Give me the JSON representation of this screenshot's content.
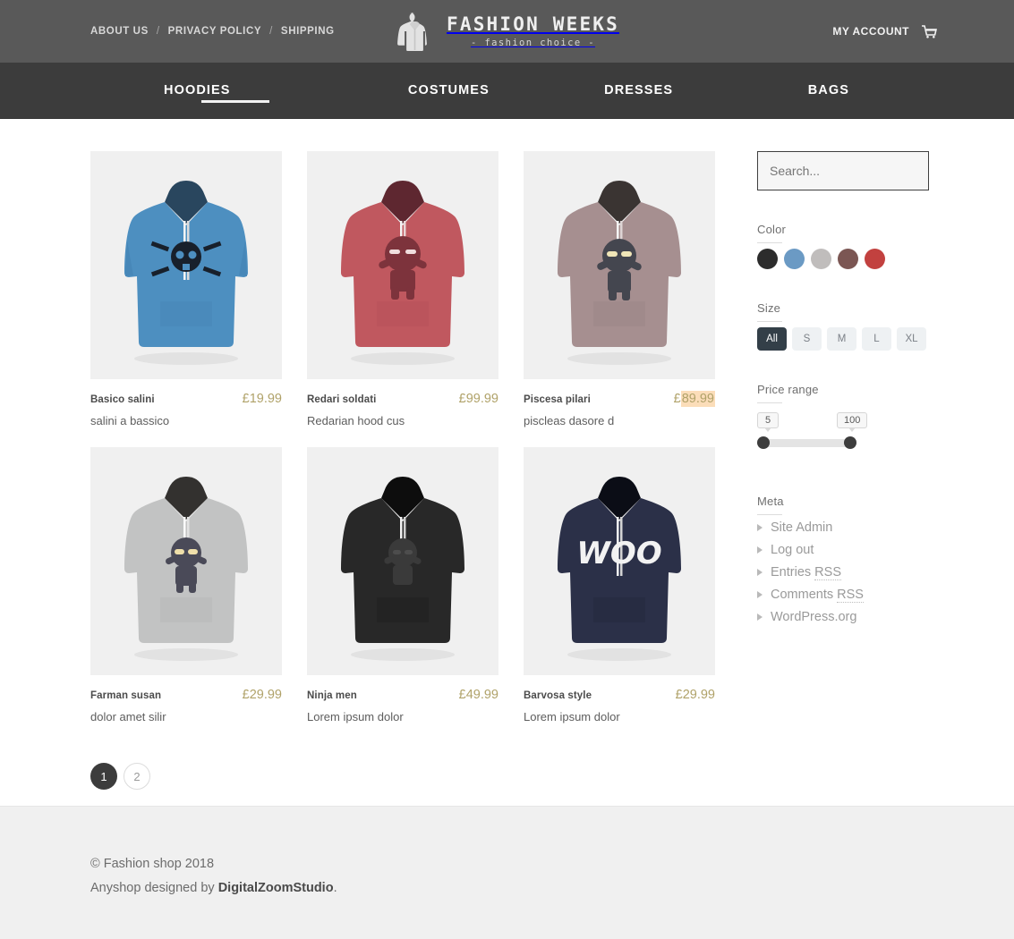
{
  "topbar": {
    "links": [
      {
        "label": "ABOUT US"
      },
      {
        "label": "PRIVACY POLICY"
      },
      {
        "label": "SHIPPING"
      }
    ],
    "separator": "/",
    "logo": {
      "title": "FASHION WEEKS",
      "subtitle": "- fashion choice -",
      "icon": "hoodie-icon"
    },
    "account_label": "MY ACCOUNT",
    "cart_icon": "shopping-cart-icon"
  },
  "nav": {
    "items": [
      {
        "label": "HOODIES",
        "active": true
      },
      {
        "label": "COSTUMES",
        "active": false
      },
      {
        "label": "DRESSES",
        "active": false
      },
      {
        "label": "BAGS",
        "active": false
      }
    ]
  },
  "products": [
    {
      "name": "Basico salini",
      "price": "£19.99",
      "desc": "salini a bassico",
      "selected_price": false,
      "image": "blue-skull-hoodie"
    },
    {
      "name": "Redari soldati",
      "price": "£99.99",
      "desc": "Redarian hood cus",
      "selected_price": false,
      "image": "red-ninja-hoodie"
    },
    {
      "name": "Piscesa pilari",
      "price": "£89.99",
      "desc": "piscleas dasore d",
      "selected_price": true,
      "image": "mauve-ninja-hoodie"
    },
    {
      "name": "Farman susan",
      "price": "£29.99",
      "desc": "dolor amet silir",
      "selected_price": false,
      "image": "gray-ninja-hoodie"
    },
    {
      "name": "Ninja men",
      "price": "£49.99",
      "desc": "Lorem ipsum dolor",
      "selected_price": false,
      "image": "black-ninja-hoodie"
    },
    {
      "name": "Barvosa style",
      "price": "£29.99",
      "desc": "Lorem ipsum dolor",
      "selected_price": false,
      "image": "navy-woo-hoodie"
    }
  ],
  "pagination": {
    "pages": [
      {
        "label": "1",
        "current": true
      },
      {
        "label": "2",
        "current": false
      }
    ]
  },
  "sidebar": {
    "search": {
      "placeholder": "Search...",
      "value": ""
    },
    "color": {
      "title": "Color",
      "swatches": [
        {
          "name": "charcoal",
          "hex": "#2c2c2c"
        },
        {
          "name": "steel-blue",
          "hex": "#6b9ac4"
        },
        {
          "name": "light-gray",
          "hex": "#c0bdbc"
        },
        {
          "name": "brown",
          "hex": "#7b5653"
        },
        {
          "name": "red",
          "hex": "#c2413f"
        }
      ]
    },
    "size": {
      "title": "Size",
      "options": [
        {
          "label": "All",
          "active": true
        },
        {
          "label": "S",
          "active": false
        },
        {
          "label": "M",
          "active": false
        },
        {
          "label": "L",
          "active": false
        },
        {
          "label": "XL",
          "active": false
        }
      ]
    },
    "price_range": {
      "title": "Price range",
      "min": "5",
      "max": "100"
    },
    "meta": {
      "title": "Meta",
      "items": [
        {
          "label": "Site Admin",
          "abbr": ""
        },
        {
          "label": "Log out",
          "abbr": ""
        },
        {
          "label": "Entries ",
          "abbr": "RSS"
        },
        {
          "label": "Comments ",
          "abbr": "RSS"
        },
        {
          "label": "WordPress.org",
          "abbr": ""
        }
      ]
    }
  },
  "footer": {
    "copyright": "© Fashion shop 2018",
    "credit_prefix": "Anyshop designed by ",
    "credit_link": "DigitalZoomStudio",
    "credit_suffix": "."
  }
}
